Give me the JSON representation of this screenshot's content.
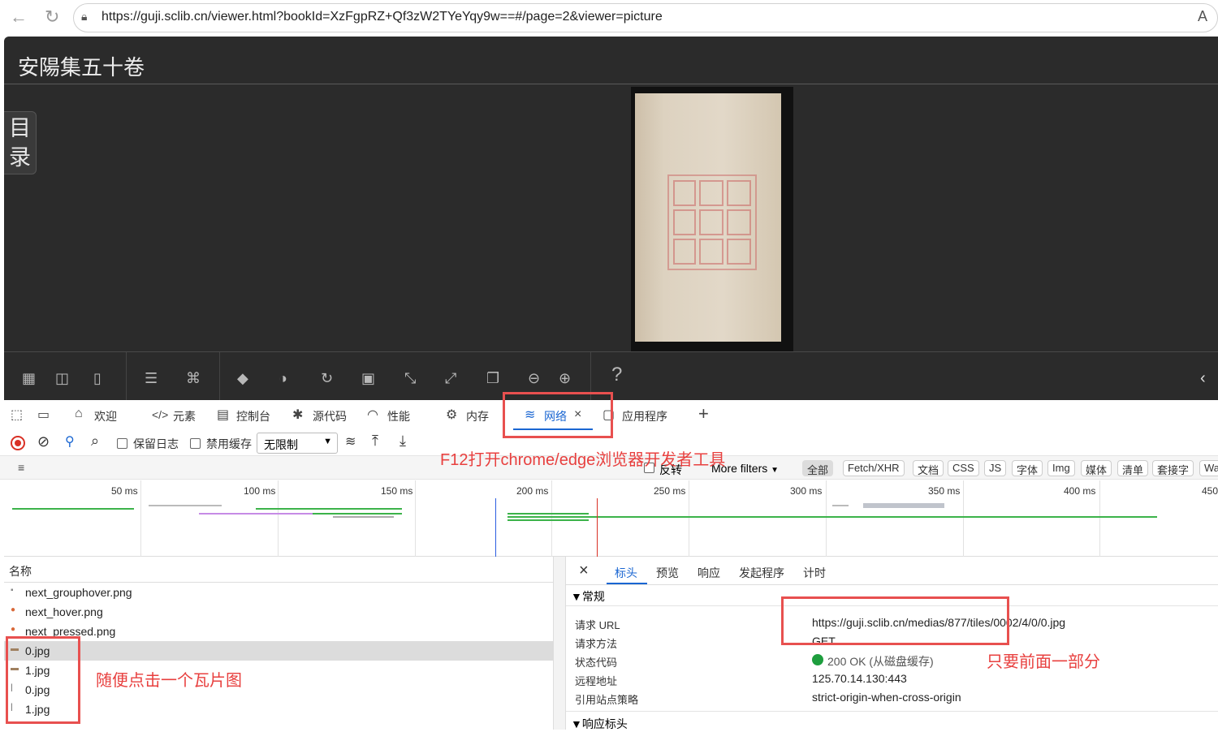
{
  "browser": {
    "url": "https://guji.sclib.cn/viewer.html?bookId=XzFgpRZ+Qf3zW2TYeYqy9w==#/page=2&viewer=picture"
  },
  "viewer": {
    "title": "安陽集五十卷",
    "toc_label": "目录",
    "help_label": "?"
  },
  "devtools": {
    "tabs": {
      "welcome": "欢迎",
      "elements": "元素",
      "console": "控制台",
      "sources": "源代码",
      "performance": "性能",
      "memory": "内存",
      "network": "网络",
      "application": "应用程序"
    },
    "toolbar": {
      "preserve_log": "保留日志",
      "disable_cache": "禁用缓存",
      "throttle": "无限制"
    },
    "filters": {
      "invert": "反转",
      "more_filters": "More filters",
      "chips": [
        "全部",
        "Fetch/XHR",
        "文档",
        "CSS",
        "JS",
        "字体",
        "Img",
        "媒体",
        "清单",
        "套接字",
        "Wa"
      ]
    },
    "timeline_ticks": [
      "50 ms",
      "100 ms",
      "150 ms",
      "200 ms",
      "250 ms",
      "300 ms",
      "350 ms",
      "400 ms",
      "450"
    ],
    "request_list": {
      "header": "名称",
      "rows": [
        "next_grouphover.png",
        "next_hover.png",
        "next_pressed.png",
        "0.jpg",
        "1.jpg",
        "0.jpg",
        "1.jpg"
      ]
    },
    "detail": {
      "tabs": [
        "标头",
        "预览",
        "响应",
        "发起程序",
        "计时"
      ],
      "section_general": "▼常规",
      "fields": [
        {
          "key": "请求 URL",
          "value": "https://guji.sclib.cn/medias/877/tiles/0002/4/0/0.jpg"
        },
        {
          "key": "请求方法",
          "value": "GET"
        },
        {
          "key": "状态代码",
          "value": "200 OK (从磁盘缓存)"
        },
        {
          "key": "远程地址",
          "value": "125.70.14.130:443"
        },
        {
          "key": "引用站点策略",
          "value": "strict-origin-when-cross-origin"
        }
      ],
      "section_response": "▼响应标头"
    }
  },
  "annotations": {
    "f12_hint": "F12打开chrome/edge浏览器开发者工具",
    "click_tile_hint": "随便点击一个瓦片图",
    "prefix_hint": "只要前面一部分"
  },
  "colors": {
    "annotation": "#e8504f",
    "accent_blue": "#1a66d2",
    "status_ok": "#1e9e3e"
  }
}
